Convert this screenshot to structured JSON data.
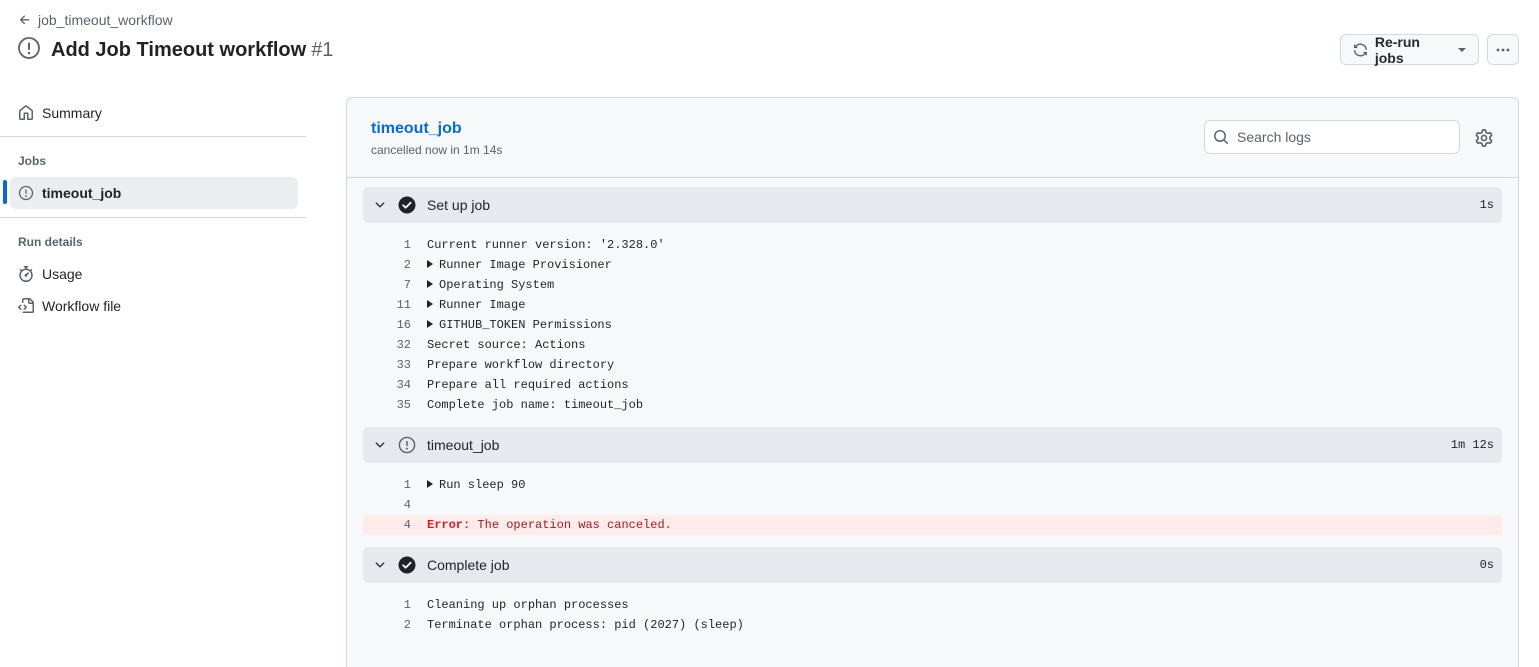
{
  "header": {
    "back_link": "job_timeout_workflow",
    "title": "Add Job Timeout workflow",
    "run_number": "#1",
    "rerun_label": "Re-run jobs"
  },
  "sidebar": {
    "summary": "Summary",
    "jobs_heading": "Jobs",
    "jobs": [
      {
        "label": "timeout_job"
      }
    ],
    "run_details_heading": "Run details",
    "usage": "Usage",
    "workflow_file": "Workflow file"
  },
  "log": {
    "job_name": "timeout_job",
    "job_status": "cancelled now in 1m 14s",
    "search_placeholder": "Search logs",
    "steps": [
      {
        "name": "Set up job",
        "duration": "1s",
        "status": "success",
        "lines": [
          {
            "n": "1",
            "text": "Current runner version: '2.328.0'",
            "collapsible": false
          },
          {
            "n": "2",
            "text": "Runner Image Provisioner",
            "collapsible": true
          },
          {
            "n": "7",
            "text": "Operating System",
            "collapsible": true
          },
          {
            "n": "11",
            "text": "Runner Image",
            "collapsible": true
          },
          {
            "n": "16",
            "text": "GITHUB_TOKEN Permissions",
            "collapsible": true
          },
          {
            "n": "32",
            "text": "Secret source: Actions",
            "collapsible": false
          },
          {
            "n": "33",
            "text": "Prepare workflow directory",
            "collapsible": false
          },
          {
            "n": "34",
            "text": "Prepare all required actions",
            "collapsible": false
          },
          {
            "n": "35",
            "text": "Complete job name: timeout_job",
            "collapsible": false
          }
        ]
      },
      {
        "name": "timeout_job",
        "duration": "1m 12s",
        "status": "cancelled",
        "lines": [
          {
            "n": "1",
            "text": "Run sleep 90",
            "collapsible": true
          },
          {
            "n": "4",
            "text": "",
            "collapsible": false
          },
          {
            "n": "4",
            "error_label": "Error:",
            "text": " The operation was canceled.",
            "error": true
          }
        ]
      },
      {
        "name": "Complete job",
        "duration": "0s",
        "status": "success",
        "lines": [
          {
            "n": "1",
            "text": "Cleaning up orphan processes",
            "collapsible": false
          },
          {
            "n": "2",
            "text": "Terminate orphan process: pid (2027) (sleep)",
            "collapsible": false
          }
        ]
      }
    ]
  },
  "colors": {
    "accent": "#0969da",
    "error_bg": "#ffebe9",
    "error_text": "#cf222e"
  }
}
